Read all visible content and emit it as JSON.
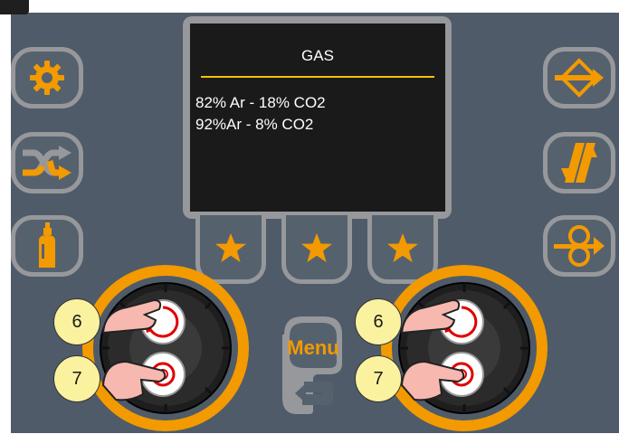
{
  "screen": {
    "title": "GAS",
    "options": [
      "82% Ar - 18% CO2",
      "92%Ar - 8% CO2"
    ]
  },
  "side_buttons_left": [
    "gear-icon",
    "shuffle-icon",
    "gas-bottle-icon"
  ],
  "side_buttons_right": [
    "diamond-arrow-icon",
    "double-arrow-icon",
    "wire-feed-icon"
  ],
  "favorite_buttons": [
    "star-icon",
    "star-icon",
    "star-icon"
  ],
  "menu": {
    "label": "Menu",
    "icon": "return-arrow-icon"
  },
  "badges": {
    "turn": "6",
    "press": "7"
  },
  "colors": {
    "accent": "#f29a00",
    "panel": "#4f5b69",
    "frame": "#97989b",
    "screen": "#1a1a1a",
    "underline": "#f2c500"
  }
}
